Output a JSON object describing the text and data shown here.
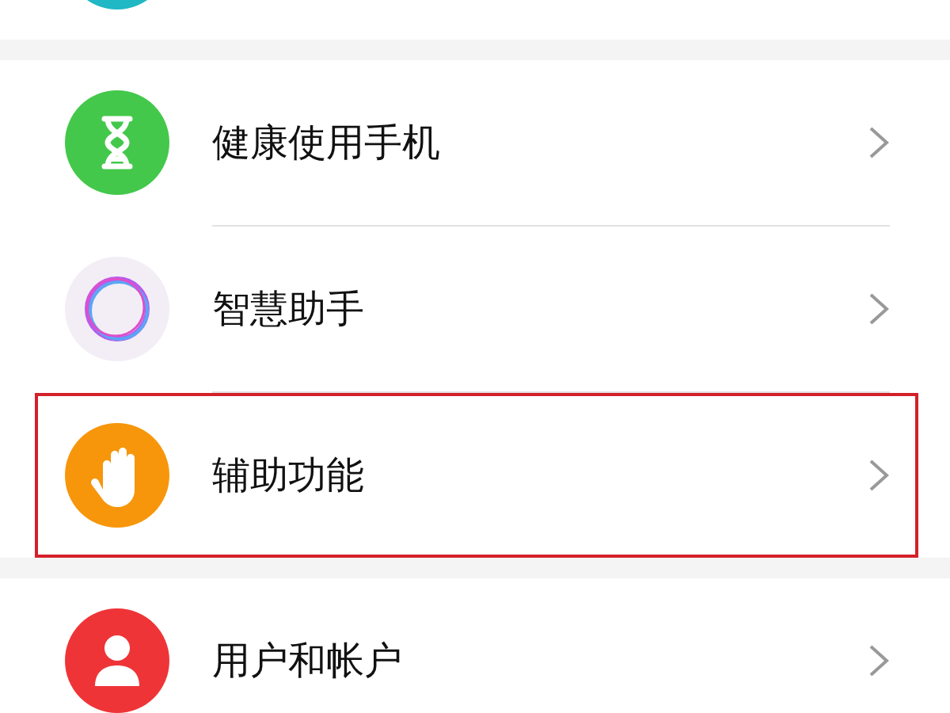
{
  "groups": [
    {
      "items": [
        {
          "kind": "circle",
          "color": "#1fb8c4",
          "highlighted": false
        }
      ]
    },
    {
      "items": [
        {
          "label": "健康使用手机",
          "kind": "hourglass",
          "color": "#43c84b",
          "highlighted": false
        },
        {
          "label": "智慧助手",
          "kind": "orb",
          "color": "#f3eef6",
          "highlighted": false
        },
        {
          "label": "辅助功能",
          "kind": "hand",
          "color": "#f7960b",
          "highlighted": true
        }
      ]
    },
    {
      "items": [
        {
          "label": "用户和帐户",
          "kind": "person",
          "color": "#ef3437",
          "highlighted": false
        }
      ]
    }
  ]
}
